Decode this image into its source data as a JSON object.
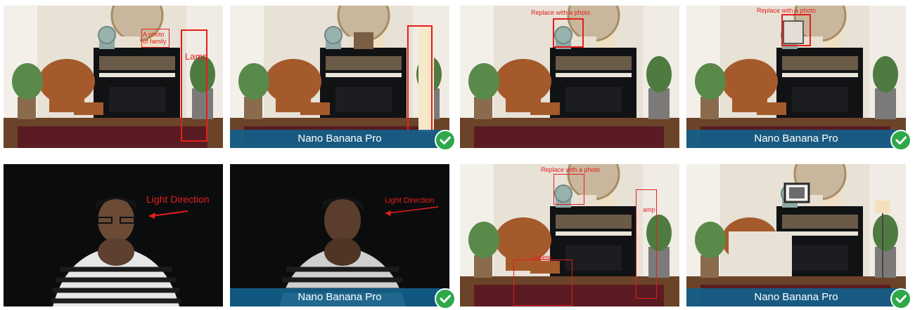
{
  "labels": {
    "family_photo": "A photo\nof family",
    "lamp": "Lamp",
    "replace_photo": "Replace with a photo",
    "light_direction": "Light Direction",
    "lamp_partial": "amp",
    "delete": "Delete"
  },
  "caption": "Nano Banana Pro",
  "colors": {
    "annotation": "#e41e1e",
    "caption_bar": "#12608a",
    "check_badge": "#2ea84a"
  },
  "icons": {
    "check": "check-icon"
  }
}
